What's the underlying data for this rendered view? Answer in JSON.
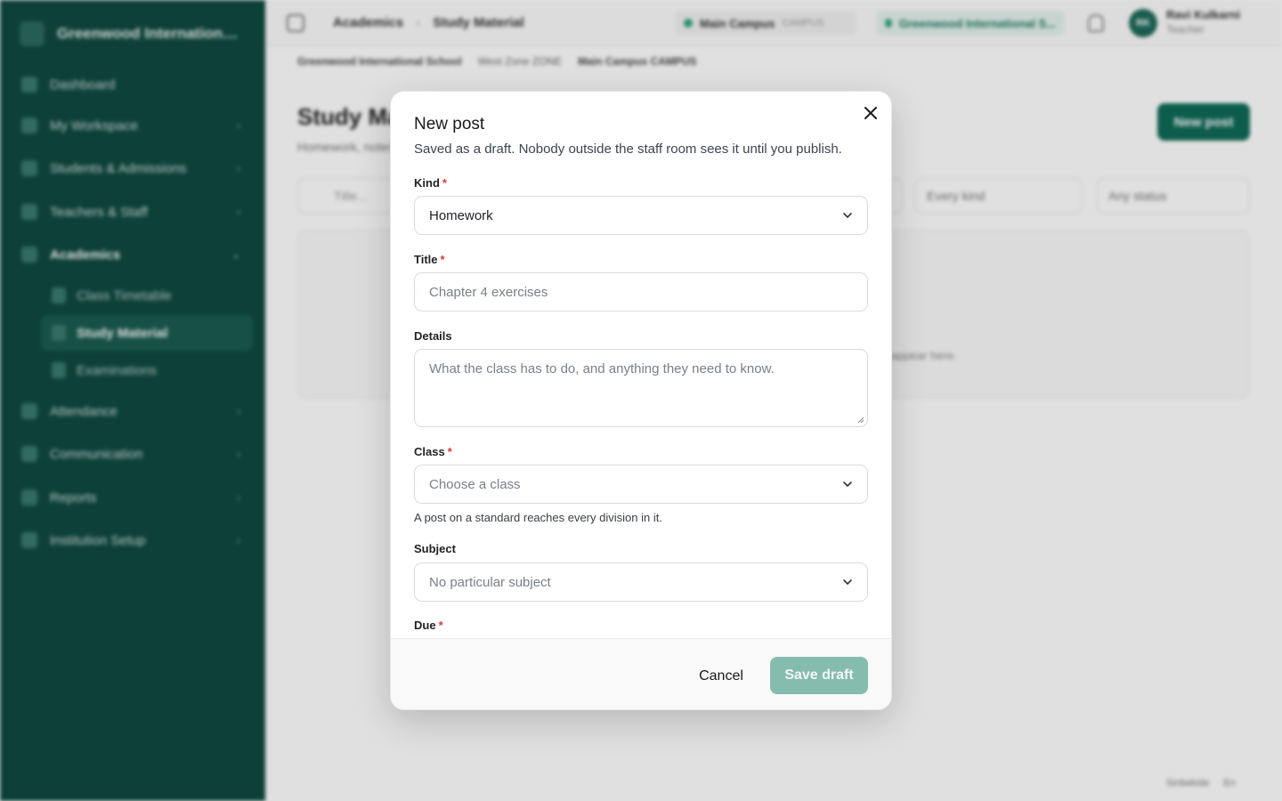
{
  "sidebar": {
    "school_name": "Greenwood International Sc...",
    "items": [
      {
        "label": "Dashboard"
      },
      {
        "label": "My Workspace"
      },
      {
        "label": "Students & Admissions"
      },
      {
        "label": "Teachers & Staff"
      },
      {
        "label": "Academics"
      },
      {
        "label": "Attendance"
      },
      {
        "label": "Communication"
      },
      {
        "label": "Reports"
      },
      {
        "label": "Institution Setup"
      }
    ],
    "academics_children": [
      {
        "label": "Class Timetable"
      },
      {
        "label": "Study Material"
      },
      {
        "label": "Examinations"
      }
    ]
  },
  "topbar": {
    "crumb_1": "Academics",
    "crumb_2": "Study Material",
    "campus": "Main Campus",
    "campus_tag": "CAMPUS",
    "school": "Greenwood International S...",
    "avatar_initials": "RK",
    "user_name": "Ravi Kulkarni",
    "user_role": "Teacher"
  },
  "subcrumb": {
    "school": "Greenwood International School",
    "zone": "West Zone",
    "zone_tag": "ZONE",
    "campus": "Main Campus",
    "campus_tag": "CAMPUS"
  },
  "page": {
    "title": "Study Material",
    "subtitle": "Homework, notes and ...",
    "new_post_label": "New post",
    "search_placeholder": "Title...",
    "filter_kind": "Every kind",
    "filter_status": "Any status",
    "empty_text": "...appear here.",
    "footer_badge": "Sinbekide",
    "footer_lang": "En"
  },
  "modal": {
    "title": "New post",
    "description": "Saved as a draft. Nobody outside the staff room sees it until you publish.",
    "kind": {
      "label": "Kind",
      "required": "*",
      "value": "Homework"
    },
    "title_field": {
      "label": "Title",
      "required": "*",
      "placeholder": "Chapter 4 exercises"
    },
    "details": {
      "label": "Details",
      "placeholder": "What the class has to do, and anything they need to know."
    },
    "class_field": {
      "label": "Class",
      "required": "*",
      "placeholder": "Choose a class",
      "hint": "A post on a standard reaches every division in it."
    },
    "subject": {
      "label": "Subject",
      "placeholder": "No particular subject"
    },
    "due": {
      "label": "Due",
      "required": "*"
    },
    "cancel_label": "Cancel",
    "save_label": "Save draft"
  },
  "colors": {
    "sidebar_bg": "#0f4a40",
    "brand": "#0f6a58",
    "save_disabled": "#86bcae",
    "required": "#d23b3b"
  }
}
